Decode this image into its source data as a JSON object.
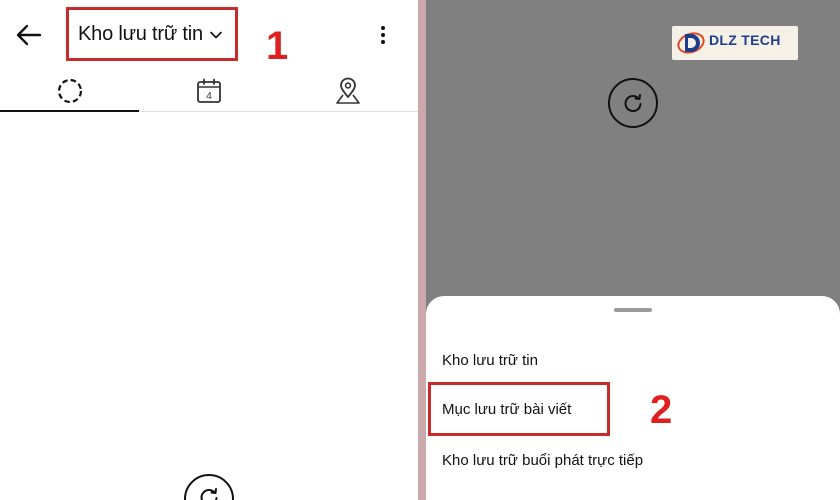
{
  "left": {
    "title": "Kho lưu trữ tin",
    "step_number": "1",
    "tabs": [
      {
        "name": "stories-tab",
        "icon": "dashed-circle-icon",
        "active": true
      },
      {
        "name": "calendar-tab",
        "icon": "calendar-icon",
        "label": "4"
      },
      {
        "name": "map-tab",
        "icon": "map-pin-icon"
      }
    ]
  },
  "right": {
    "logo_text": "DLZ TECH",
    "menu": {
      "items": [
        "Kho lưu trữ tin",
        "Mục lưu trữ bài viết",
        "Kho lưu trữ buổi phát trực tiếp"
      ]
    },
    "step_number": "2"
  },
  "colors": {
    "highlight": "#c92a2a",
    "step_number": "#e02020",
    "overlay": "#808080"
  }
}
